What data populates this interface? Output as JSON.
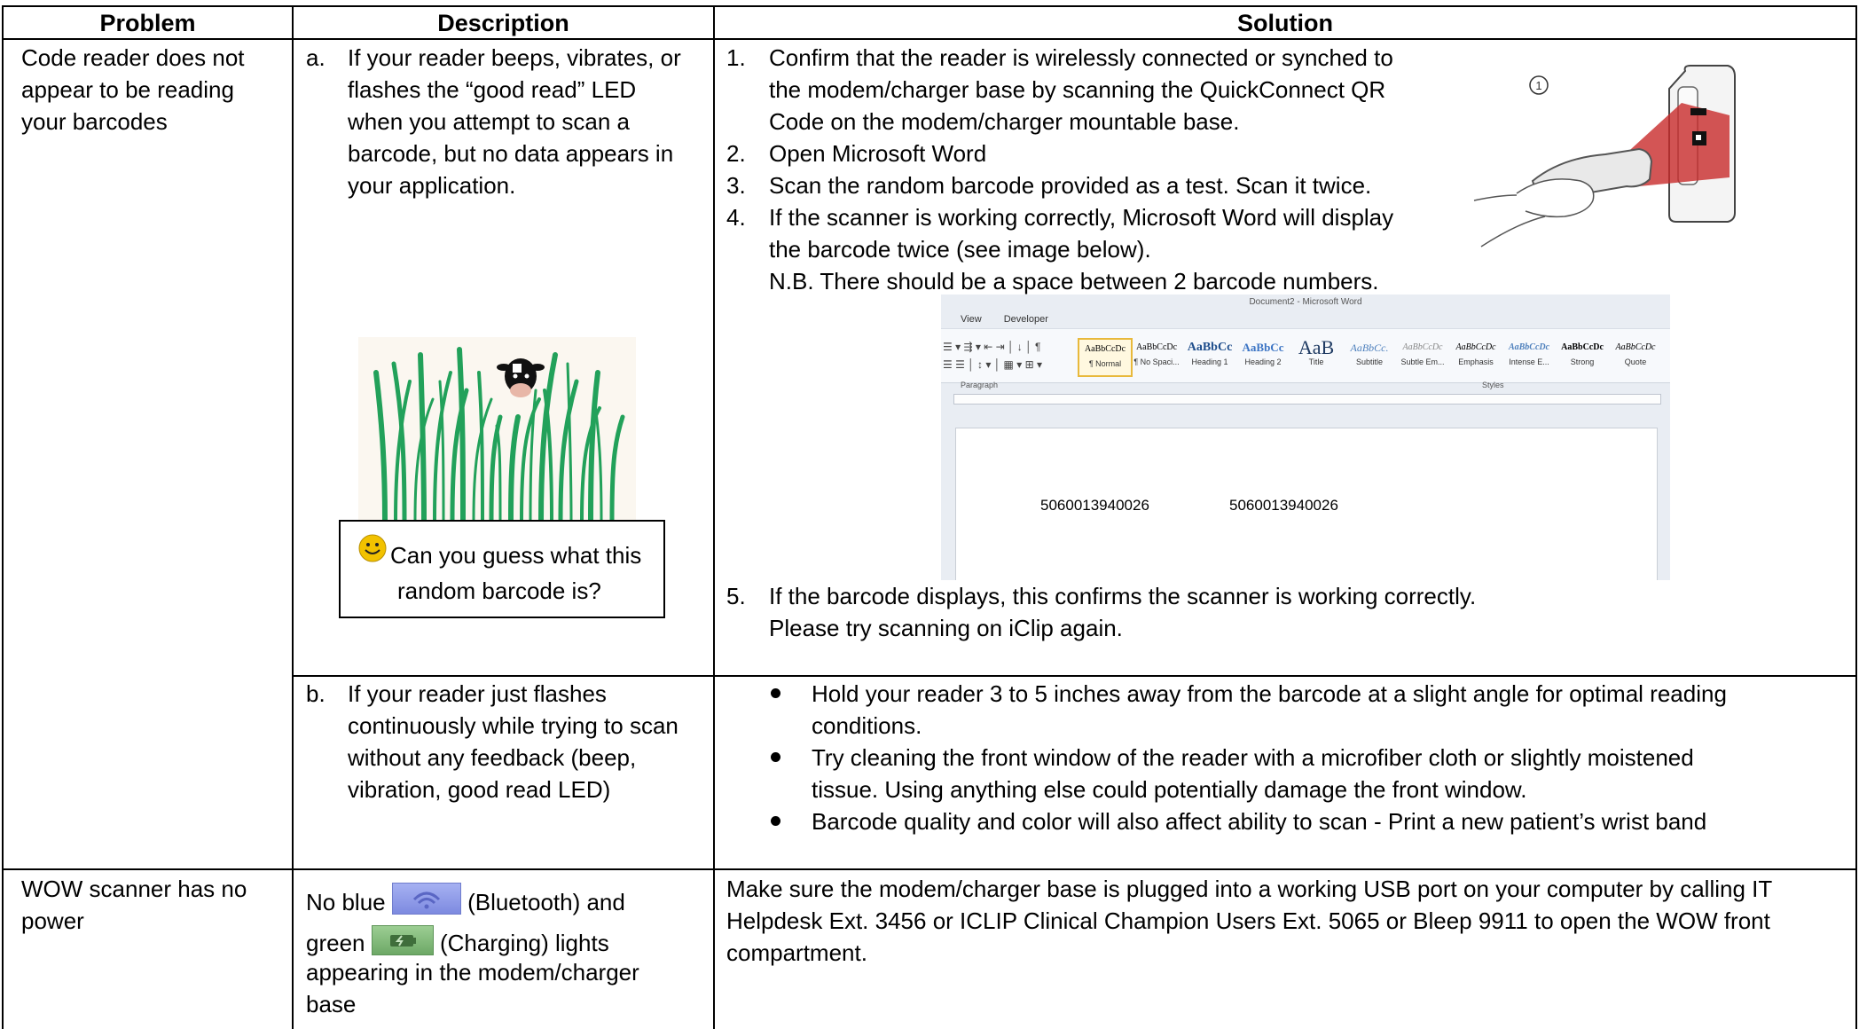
{
  "table": {
    "headers": {
      "problem": "Problem",
      "description": "Description",
      "solution": "Solution"
    },
    "row1": {
      "problem_lines": [
        "Code reader does not",
        "appear to be reading",
        "your barcodes"
      ],
      "desc_a_marker": "a.",
      "desc_a_lines": [
        "If your reader beeps, vibrates, or",
        "flashes the “good read” LED",
        "when you attempt to scan a",
        "barcode, but no data appears in",
        "your application."
      ],
      "callout_lines": [
        "Can you guess what this",
        "random barcode is?"
      ],
      "steps": [
        {
          "num": "1.",
          "lines": [
            "Confirm that the reader is wirelessly connected or synched to",
            "the modem/charger base by scanning the QuickConnect QR",
            "Code on the modem/charger mountable base."
          ]
        },
        {
          "num": "2.",
          "lines": [
            "Open Microsoft Word"
          ]
        },
        {
          "num": "3.",
          "lines": [
            "Scan the random barcode provided as a test. Scan it twice."
          ]
        },
        {
          "num": "4.",
          "lines": [
            "If the scanner is working correctly, Microsoft Word will display",
            "the barcode twice (see image below).",
            "N.B. There should be a space between 2 barcode numbers."
          ]
        },
        {
          "num": "5.",
          "lines": [
            "If the barcode displays, this confirms the scanner is working correctly.",
            "Please try scanning on iClip again."
          ]
        }
      ],
      "scanner_callout": "1",
      "word_screenshot": {
        "title": "Document2 - Microsoft Word",
        "menus": [
          "View",
          "Developer"
        ],
        "group_paragraph": "Paragraph",
        "group_styles": "Styles",
        "styles": [
          {
            "preview": "AaBbCcDc",
            "name": "¶ Normal"
          },
          {
            "preview": "AaBbCcDc",
            "name": "¶ No Spaci..."
          },
          {
            "preview": "AaBbCc",
            "name": "Heading 1"
          },
          {
            "preview": "AaBbCc",
            "name": "Heading 2"
          },
          {
            "preview": "AaB",
            "name": "Title"
          },
          {
            "preview": "AaBbCc.",
            "name": "Subtitle"
          },
          {
            "preview": "AaBbCcDc",
            "name": "Subtle Em..."
          },
          {
            "preview": "AaBbCcDc",
            "name": "Emphasis"
          },
          {
            "preview": "AaBbCcDc",
            "name": "Intense E..."
          },
          {
            "preview": "AaBbCcDc",
            "name": "Strong"
          },
          {
            "preview": "AaBbCcDc",
            "name": "Quote"
          }
        ],
        "barcode_1": "5060013940026",
        "barcode_2": "5060013940026"
      }
    },
    "row2": {
      "desc_b_marker": "b.",
      "desc_b_lines": [
        "If your reader just flashes",
        "continuously while trying to scan",
        "without any feedback (beep,",
        "vibration, good read LED)"
      ],
      "bullets": [
        {
          "lines": [
            "Hold your reader 3 to 5 inches away from the barcode at a slight angle for optimal reading",
            "conditions."
          ]
        },
        {
          "lines": [
            "Try cleaning the front window of the reader with a microfiber cloth or slightly moistened",
            "tissue.  Using anything else could potentially damage the front window."
          ]
        },
        {
          "lines": [
            "Barcode quality and color will also affect ability to scan - Print a new patient’s wrist band"
          ]
        }
      ]
    },
    "row3": {
      "problem_lines": [
        "WOW scanner has no",
        "power"
      ],
      "desc_l1_pre": "No blue ",
      "desc_l1_post": " (Bluetooth) and",
      "desc_l2_pre": "green ",
      "desc_l2_post": " (Charging) lights",
      "desc_lines_rest": [
        "appearing in the modem/charger",
        "base"
      ],
      "solution_lines": [
        "Make sure the modem/charger base is plugged into a working USB port on your computer by calling IT",
        "Helpdesk Ext. 3456 or ICLIP Clinical Champion Users Ext. 5065 or Bleep 9911 to open the WOW front",
        "compartment."
      ]
    }
  },
  "colors": {
    "barcode_green": "#22a15a",
    "bluetooth_icon": "#8f9be8",
    "charging_icon": "#7fb877",
    "callout_smiley": "#f2c200",
    "scanner_red": "#c82a2a"
  }
}
